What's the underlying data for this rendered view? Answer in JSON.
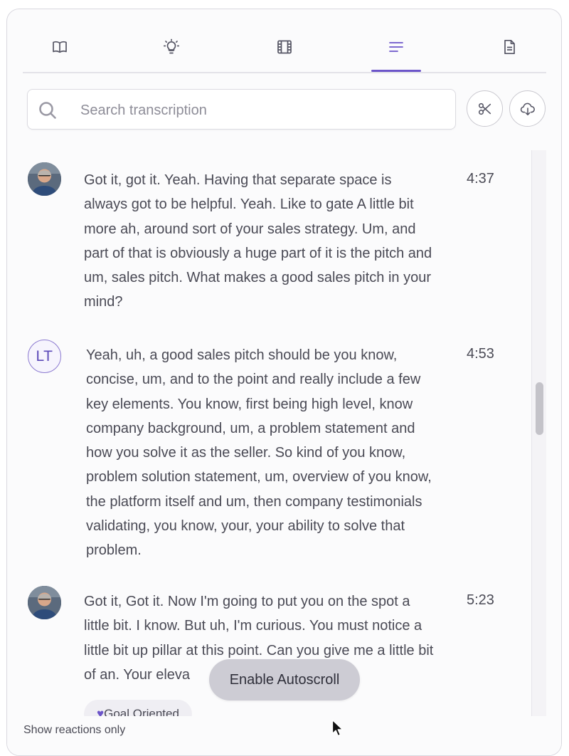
{
  "tabs": [
    {
      "id": "chapters",
      "icon": "book-icon",
      "active": false
    },
    {
      "id": "insights",
      "icon": "lightbulb-icon",
      "active": false
    },
    {
      "id": "clips",
      "icon": "film-icon",
      "active": false
    },
    {
      "id": "transcription",
      "icon": "lines-icon",
      "active": true
    },
    {
      "id": "notes",
      "icon": "document-icon",
      "active": false
    }
  ],
  "search": {
    "placeholder": "Search transcription",
    "value": ""
  },
  "actions": {
    "clip_icon": "scissors-icon",
    "download_icon": "cloud-download-icon"
  },
  "transcript": [
    {
      "speaker_avatar": "photo",
      "time": "4:37",
      "text": "Got it, got it. Yeah. Having that separate space is always got to be helpful. Yeah. Like to gate A little bit more ah, around sort of your sales strategy. Um, and part of that is obviously a huge part of it is the pitch and um, sales pitch. What makes a good sales pitch in your mind?"
    },
    {
      "speaker_initials": "LT",
      "time": "4:53",
      "text": "Yeah, uh, a good sales pitch should be you know, concise, um, and to the point and really include a few key elements. You know, first being high level, know company background, um, a problem statement and how you solve it as the seller. So kind of you know, problem solution statement, um, overview of you know, the platform itself and um, then company testimonials validating, you know, your, your ability to solve that problem."
    },
    {
      "speaker_avatar": "photo",
      "time": "5:23",
      "text": "Got it, Got it. Now I'm going to put you on the spot a little bit. I know. But uh, I'm curious. You must notice a little bit up pillar at this point. Can you give me a little bit of an. Your eleva",
      "reaction": "Goal Oriented"
    }
  ],
  "autoscroll_label": "Enable Autoscroll",
  "footer": {
    "reactions_toggle": "Show reactions only"
  },
  "colors": {
    "accent": "#6c55c9",
    "border": "#d9d8df",
    "text": "#4a4a55"
  }
}
